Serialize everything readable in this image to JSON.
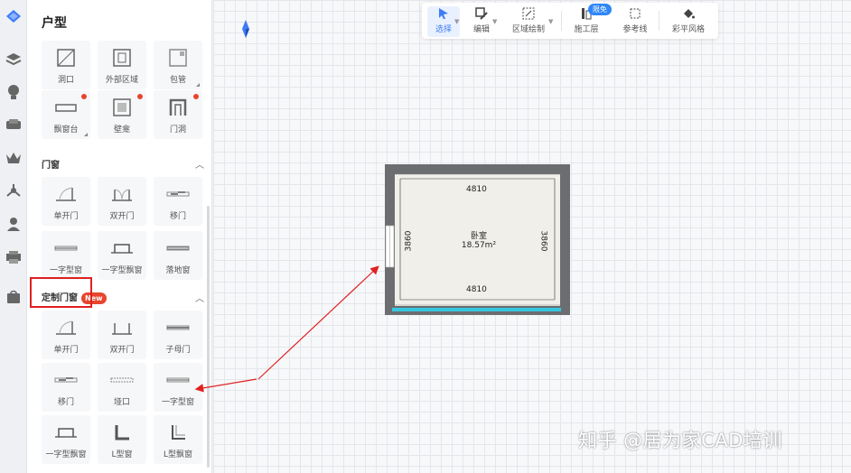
{
  "panel": {
    "title": "户型",
    "tiles_top": [
      {
        "label": "洞口",
        "dot": false,
        "corner": false
      },
      {
        "label": "外部区域",
        "dot": false,
        "corner": false
      },
      {
        "label": "包管",
        "dot": false,
        "corner": true
      },
      {
        "label": "飘窗台",
        "dot": true,
        "corner": true
      },
      {
        "label": "壁龛",
        "dot": true,
        "corner": false
      },
      {
        "label": "门洞",
        "dot": true,
        "corner": false
      }
    ],
    "doors_windows": {
      "title": "门窗",
      "tiles": [
        "单开门",
        "双开门",
        "移门",
        "一字型窗",
        "一字型飘窗",
        "落地窗"
      ]
    },
    "custom_doors_windows": {
      "title": "定制门窗",
      "badge": "New",
      "tiles": [
        "单开门",
        "双开门",
        "子母门",
        "移门",
        "垭口",
        "一字型窗",
        "一字型飘窗",
        "L型窗",
        "L型飘窗"
      ]
    }
  },
  "toolbar": {
    "items": [
      {
        "label": "选择",
        "icon": "cursor-icon"
      },
      {
        "label": "编辑",
        "icon": "edit-icon"
      },
      {
        "label": "区域绘制",
        "icon": "region-draw-icon"
      },
      {
        "label": "施工层",
        "icon": "construction-layer-icon"
      },
      {
        "label": "参考线",
        "icon": "guide-lines-icon"
      },
      {
        "label": "彩平风格",
        "icon": "paint-bucket-icon"
      }
    ],
    "limited_badge": "限免"
  },
  "room": {
    "name": "卧室",
    "area": "18.57m²",
    "dim_top": "4810",
    "dim_bottom": "4810",
    "dim_left": "3860",
    "dim_right": "3860"
  },
  "watermark": "知乎 @居为家CAD培训",
  "colors": {
    "accent": "#3e7cf6",
    "annotation_red": "#e02020",
    "wall": "#6b6d70",
    "window": "#34c8e0"
  }
}
